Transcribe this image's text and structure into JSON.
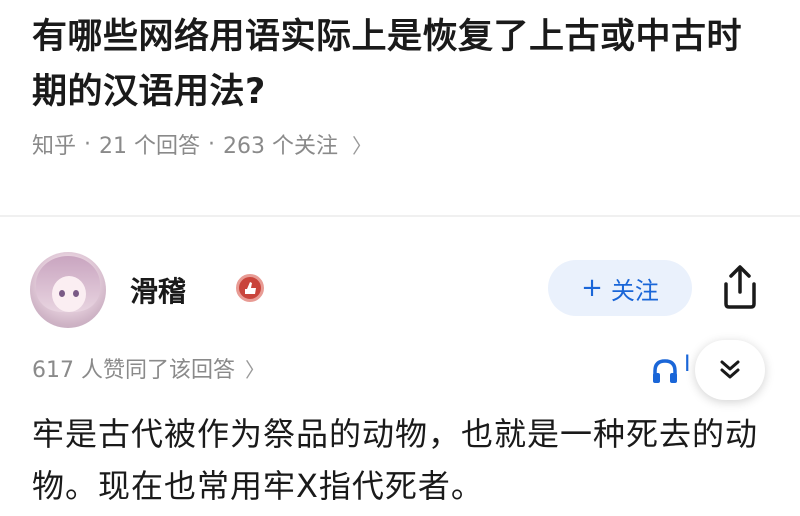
{
  "question": {
    "title": "有哪些网络用语实际上是恢复了上古或中古时期的汉语用法?",
    "source": "知乎",
    "separator": "·",
    "answers_count": "21 个回答",
    "followers_count": "263 个关注",
    "chevron": "〉"
  },
  "answer": {
    "author_name": "滑稽",
    "follow_button_plus": "+",
    "follow_button_label": "关注",
    "votes_text": "617 人赞同了该回答",
    "votes_chevron": "〉",
    "listen_label": "I",
    "body_text": "牢是古代被作为祭品的动物，也就是一种死去的动物。现在也常用牢X指代死者。"
  },
  "colors": {
    "accent": "#1a66d8",
    "follow_bg": "#eaf1fc",
    "muted_text": "#8a8a8a",
    "badge_red": "#c9443b"
  },
  "icons": [
    "avatar",
    "red-badge-icon",
    "share-icon",
    "headphone-icon",
    "chevron-down-icon"
  ]
}
